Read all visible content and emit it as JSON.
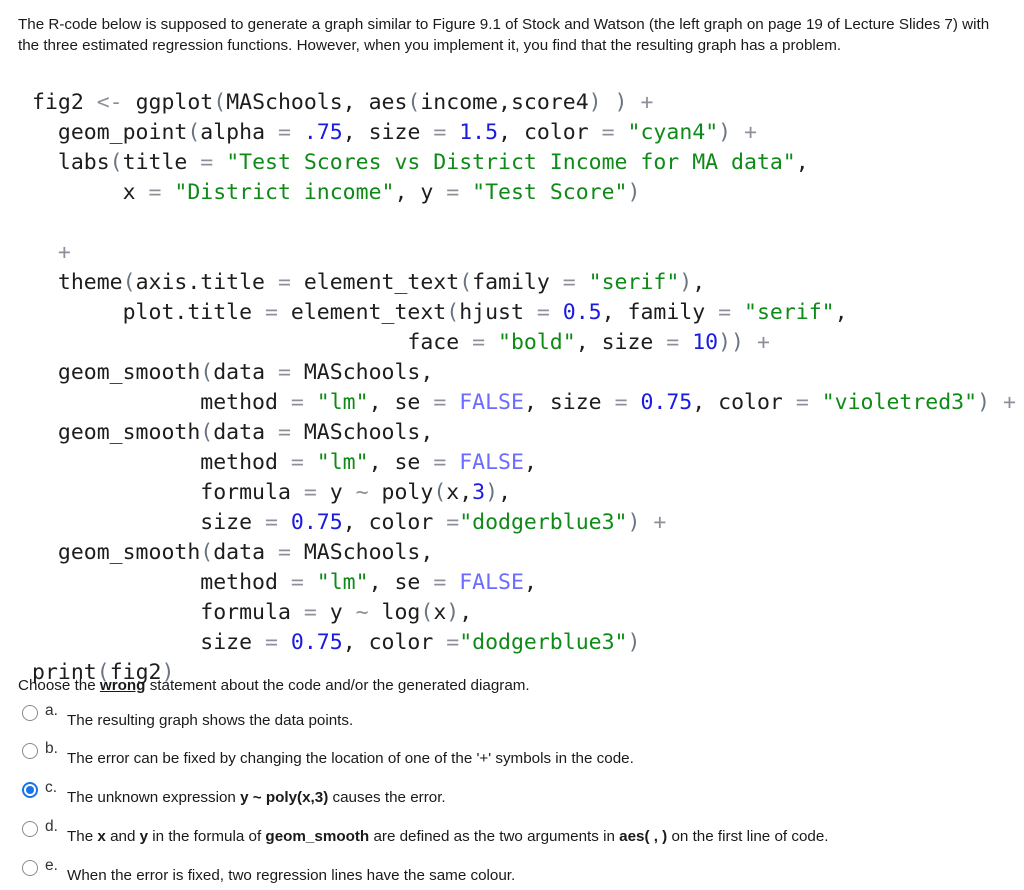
{
  "intro": "The R-code below is supposed to generate a graph similar to Figure 9.1 of Stock and Watson (the left graph on page 19 of Lecture Slides 7) with the three estimated regression functions. However, when you implement it, you find that the resulting graph has a problem.",
  "code_lines": [
    [
      [
        "plain",
        "fig2 "
      ],
      [
        "op",
        "<-"
      ],
      [
        "plain",
        " ggplot"
      ],
      [
        "paren",
        "("
      ],
      [
        "plain",
        "MASchools, aes"
      ],
      [
        "paren",
        "("
      ],
      [
        "plain",
        "income,score4"
      ],
      [
        "paren",
        ")"
      ],
      [
        "plain",
        " "
      ],
      [
        "paren",
        ")"
      ],
      [
        "plain",
        " "
      ],
      [
        "op",
        "+"
      ]
    ],
    [
      [
        "plain",
        "  geom_point"
      ],
      [
        "paren",
        "("
      ],
      [
        "plain",
        "alpha "
      ],
      [
        "op",
        "="
      ],
      [
        "plain",
        " "
      ],
      [
        "num",
        ".75"
      ],
      [
        "plain",
        ", size "
      ],
      [
        "op",
        "="
      ],
      [
        "plain",
        " "
      ],
      [
        "num",
        "1.5"
      ],
      [
        "plain",
        ", color "
      ],
      [
        "op",
        "="
      ],
      [
        "plain",
        " "
      ],
      [
        "str",
        "\"cyan4\""
      ],
      [
        "paren",
        ")"
      ],
      [
        "plain",
        " "
      ],
      [
        "op",
        "+"
      ]
    ],
    [
      [
        "plain",
        "  labs"
      ],
      [
        "paren",
        "("
      ],
      [
        "plain",
        "title "
      ],
      [
        "op",
        "="
      ],
      [
        "plain",
        " "
      ],
      [
        "str",
        "\"Test Scores vs District Income for MA data\""
      ],
      [
        "plain",
        ","
      ]
    ],
    [
      [
        "plain",
        "       x "
      ],
      [
        "op",
        "="
      ],
      [
        "plain",
        " "
      ],
      [
        "str",
        "\"District income\""
      ],
      [
        "plain",
        ", y "
      ],
      [
        "op",
        "="
      ],
      [
        "plain",
        " "
      ],
      [
        "str",
        "\"Test Score\""
      ],
      [
        "paren",
        ")"
      ]
    ],
    [],
    [
      [
        "op",
        "  +"
      ]
    ],
    [
      [
        "plain",
        "  theme"
      ],
      [
        "paren",
        "("
      ],
      [
        "plain",
        "axis.title "
      ],
      [
        "op",
        "="
      ],
      [
        "plain",
        " element_text"
      ],
      [
        "paren",
        "("
      ],
      [
        "plain",
        "family "
      ],
      [
        "op",
        "="
      ],
      [
        "plain",
        " "
      ],
      [
        "str",
        "\"serif\""
      ],
      [
        "paren",
        ")"
      ],
      [
        "plain",
        ","
      ]
    ],
    [
      [
        "plain",
        "       plot.title "
      ],
      [
        "op",
        "="
      ],
      [
        "plain",
        " element_text"
      ],
      [
        "paren",
        "("
      ],
      [
        "plain",
        "hjust "
      ],
      [
        "op",
        "="
      ],
      [
        "plain",
        " "
      ],
      [
        "num",
        "0.5"
      ],
      [
        "plain",
        ", family "
      ],
      [
        "op",
        "="
      ],
      [
        "plain",
        " "
      ],
      [
        "str",
        "\"serif\""
      ],
      [
        "plain",
        ","
      ]
    ],
    [
      [
        "plain",
        "                             face "
      ],
      [
        "op",
        "="
      ],
      [
        "plain",
        " "
      ],
      [
        "str",
        "\"bold\""
      ],
      [
        "plain",
        ", size "
      ],
      [
        "op",
        "="
      ],
      [
        "plain",
        " "
      ],
      [
        "num",
        "10"
      ],
      [
        "paren",
        "))"
      ],
      [
        "plain",
        " "
      ],
      [
        "op",
        "+"
      ]
    ],
    [
      [
        "plain",
        "  geom_smooth"
      ],
      [
        "paren",
        "("
      ],
      [
        "plain",
        "data "
      ],
      [
        "op",
        "="
      ],
      [
        "plain",
        " MASchools,"
      ]
    ],
    [
      [
        "plain",
        "             method "
      ],
      [
        "op",
        "="
      ],
      [
        "plain",
        " "
      ],
      [
        "str",
        "\"lm\""
      ],
      [
        "plain",
        ", se "
      ],
      [
        "op",
        "="
      ],
      [
        "plain",
        " "
      ],
      [
        "kw",
        "FALSE"
      ],
      [
        "plain",
        ", size "
      ],
      [
        "op",
        "="
      ],
      [
        "plain",
        " "
      ],
      [
        "num",
        "0.75"
      ],
      [
        "plain",
        ", color "
      ],
      [
        "op",
        "="
      ],
      [
        "plain",
        " "
      ],
      [
        "str",
        "\"violetred3\""
      ],
      [
        "paren",
        ")"
      ],
      [
        "plain",
        " "
      ],
      [
        "op",
        "+"
      ]
    ],
    [
      [
        "plain",
        "  geom_smooth"
      ],
      [
        "paren",
        "("
      ],
      [
        "plain",
        "data "
      ],
      [
        "op",
        "="
      ],
      [
        "plain",
        " MASchools,"
      ]
    ],
    [
      [
        "plain",
        "             method "
      ],
      [
        "op",
        "="
      ],
      [
        "plain",
        " "
      ],
      [
        "str",
        "\"lm\""
      ],
      [
        "plain",
        ", se "
      ],
      [
        "op",
        "="
      ],
      [
        "plain",
        " "
      ],
      [
        "kw",
        "FALSE"
      ],
      [
        "plain",
        ","
      ]
    ],
    [
      [
        "plain",
        "             formula "
      ],
      [
        "op",
        "="
      ],
      [
        "plain",
        " y "
      ],
      [
        "op",
        "~"
      ],
      [
        "plain",
        " poly"
      ],
      [
        "paren",
        "("
      ],
      [
        "plain",
        "x,"
      ],
      [
        "num",
        "3"
      ],
      [
        "paren",
        ")"
      ],
      [
        "plain",
        ","
      ]
    ],
    [
      [
        "plain",
        "             size "
      ],
      [
        "op",
        "="
      ],
      [
        "plain",
        " "
      ],
      [
        "num",
        "0.75"
      ],
      [
        "plain",
        ", color "
      ],
      [
        "op",
        "="
      ],
      [
        "str",
        "\"dodgerblue3\""
      ],
      [
        "paren",
        ")"
      ],
      [
        "plain",
        " "
      ],
      [
        "op",
        "+"
      ]
    ],
    [
      [
        "plain",
        "  geom_smooth"
      ],
      [
        "paren",
        "("
      ],
      [
        "plain",
        "data "
      ],
      [
        "op",
        "="
      ],
      [
        "plain",
        " MASchools,"
      ]
    ],
    [
      [
        "plain",
        "             method "
      ],
      [
        "op",
        "="
      ],
      [
        "plain",
        " "
      ],
      [
        "str",
        "\"lm\""
      ],
      [
        "plain",
        ", se "
      ],
      [
        "op",
        "="
      ],
      [
        "plain",
        " "
      ],
      [
        "kw",
        "FALSE"
      ],
      [
        "plain",
        ","
      ]
    ],
    [
      [
        "plain",
        "             formula "
      ],
      [
        "op",
        "="
      ],
      [
        "plain",
        " y "
      ],
      [
        "op",
        "~"
      ],
      [
        "plain",
        " log"
      ],
      [
        "paren",
        "("
      ],
      [
        "plain",
        "x"
      ],
      [
        "paren",
        ")"
      ],
      [
        "plain",
        ","
      ]
    ],
    [
      [
        "plain",
        "             size "
      ],
      [
        "op",
        "="
      ],
      [
        "plain",
        " "
      ],
      [
        "num",
        "0.75"
      ],
      [
        "plain",
        ", color "
      ],
      [
        "op",
        "="
      ],
      [
        "str",
        "\"dodgerblue3\""
      ],
      [
        "paren",
        ")"
      ]
    ],
    [
      [
        "plain",
        "print"
      ],
      [
        "paren",
        "("
      ],
      [
        "plain",
        "fig2"
      ],
      [
        "paren",
        ")"
      ]
    ]
  ],
  "question": {
    "prefix": "Choose the ",
    "emphasis": "wrong",
    "suffix": " statement about the code and/or the generated diagram."
  },
  "options": [
    {
      "letter": "a.",
      "checked": false,
      "parts": [
        [
          "t",
          "The resulting graph shows the data points."
        ]
      ]
    },
    {
      "letter": "b.",
      "checked": false,
      "parts": [
        [
          "t",
          "The error can be fixed by changing the location of one of the '+' symbols in the code."
        ]
      ]
    },
    {
      "letter": "c.",
      "checked": true,
      "parts": [
        [
          "t",
          "The unknown expression "
        ],
        [
          "b",
          "y ~ poly(x,3)"
        ],
        [
          "t",
          " causes the error."
        ]
      ]
    },
    {
      "letter": "d.",
      "checked": false,
      "parts": [
        [
          "t",
          "The "
        ],
        [
          "b",
          "x"
        ],
        [
          "t",
          " and "
        ],
        [
          "b",
          "y"
        ],
        [
          "t",
          " in the formula of "
        ],
        [
          "b",
          "geom_smooth"
        ],
        [
          "t",
          " are defined as the two arguments in "
        ],
        [
          "b",
          "aes( , )"
        ],
        [
          "t",
          " on the first line of code."
        ]
      ]
    },
    {
      "letter": "e.",
      "checked": false,
      "parts": [
        [
          "t",
          "When the error is fixed, two regression lines have the same colour."
        ]
      ]
    }
  ],
  "colors": {
    "radio_selected": "#1a73e8",
    "code_string": "#0e8a16",
    "code_number": "#1a1ae0",
    "code_keyword": "#6b6bff"
  }
}
